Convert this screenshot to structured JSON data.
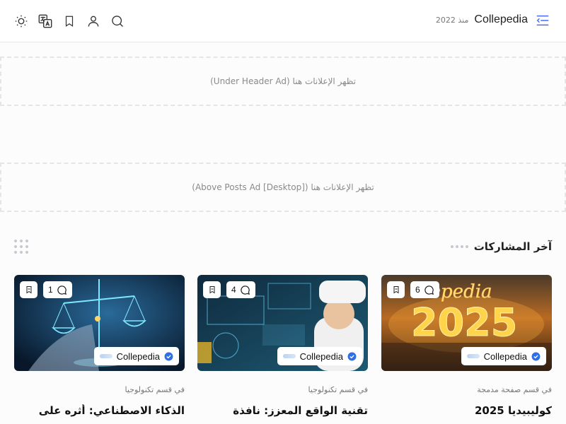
{
  "header": {
    "brand_name": "Collepedia",
    "brand_since": "منذ 2022",
    "icons": [
      "sun-icon",
      "translate-icon",
      "bookmark-icon",
      "user-icon",
      "search-icon",
      "menu-icon"
    ]
  },
  "ads": {
    "under_header": "تظهر الإعلانات هنا (Under Header Ad)",
    "above_posts": "تظهر الإعلانات هنا (Above Posts Ad [Desktop])"
  },
  "section": {
    "title": "آخر المشاركات"
  },
  "colors": {
    "verified": "#2f6fe4",
    "accent": "#4a6cf7"
  },
  "posts": [
    {
      "comments": "6",
      "author": "Collepedia",
      "category": "في قسم صفحة مدمجة",
      "title": "كوليبيديا 2025"
    },
    {
      "comments": "4",
      "author": "Collepedia",
      "category": "في قسم تكنولوجيا",
      "title": "تقنية الواقع المعزز: نافذة"
    },
    {
      "comments": "1",
      "author": "Collepedia",
      "category": "في قسم تكنولوجيا",
      "title": "الذكاء الاصطناعي: أثره على"
    }
  ]
}
